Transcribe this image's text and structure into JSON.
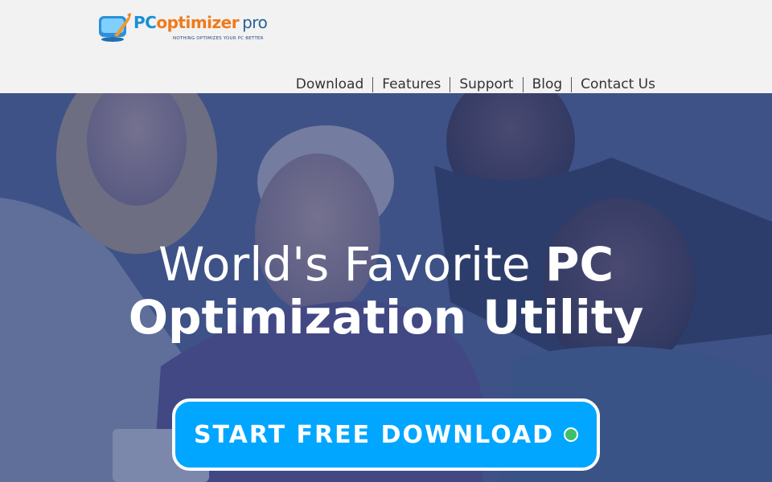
{
  "header": {
    "logo": {
      "brand_pc": "PC",
      "brand_optimizer": "optimizer",
      "brand_pro": "pro",
      "tagline": "NOTHING OPTIMIZES YOUR PC BETTER"
    },
    "nav": [
      {
        "label": "Download"
      },
      {
        "label": "Features"
      },
      {
        "label": "Support"
      },
      {
        "label": "Blog"
      },
      {
        "label": "Contact Us"
      }
    ]
  },
  "hero": {
    "headline_light": "World's Favorite ",
    "headline_bold1": "PC",
    "headline_bold2": "Optimization Utility",
    "cta_label": "START FREE DOWNLOAD"
  },
  "colors": {
    "header_bg": "#f2f2f2",
    "overlay": "#30468a",
    "cta_bg": "#00a6ff",
    "cta_dot": "#3ec06b",
    "brand_blue": "#1a8fd6",
    "brand_orange": "#f07a1a"
  },
  "icons": {
    "logo": "pcoptimizer-logo-icon",
    "cta_indicator": "green-dot-icon"
  }
}
